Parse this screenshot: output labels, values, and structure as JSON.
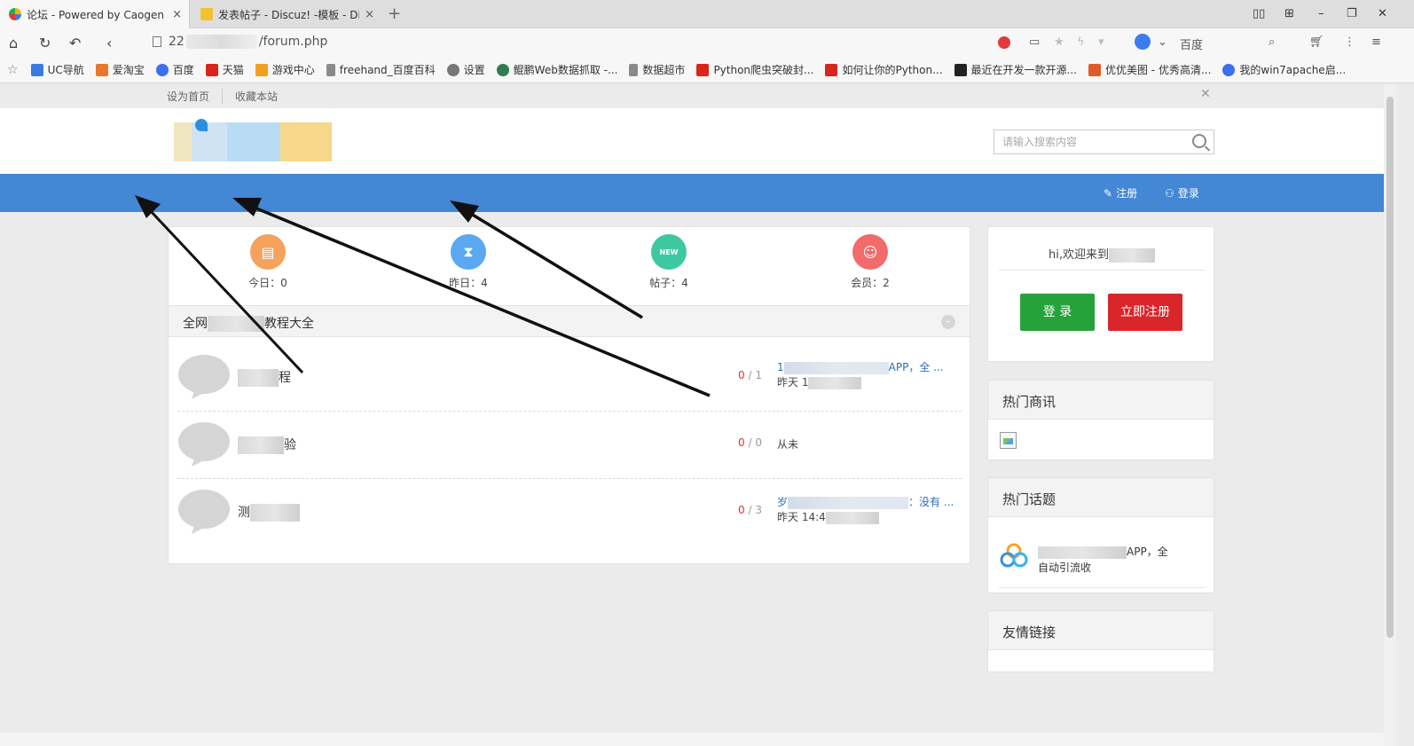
{
  "browser": {
    "tabs": [
      {
        "title": "论坛 - Powered by Caogen",
        "close": "×"
      },
      {
        "title": "发表帖子 - Discuz! -模板 - Di",
        "close": "×"
      }
    ],
    "new_tab": "+",
    "url": {
      "prefix": "22",
      "path": "/forum.php"
    },
    "search_engine": "百度",
    "bookmarks": [
      {
        "label": "UC导航",
        "color": "#3a7be0"
      },
      {
        "label": "爱淘宝",
        "color": "#e8772e"
      },
      {
        "label": "百度",
        "color": "#3b6ef0"
      },
      {
        "label": "天猫",
        "color": "#d8261b"
      },
      {
        "label": "游戏中心",
        "color": "#f0a020"
      },
      {
        "label": "freehand_百度百科",
        "color": "#8a8a8a"
      },
      {
        "label": "设置",
        "color": "#777777"
      },
      {
        "label": "鲲鹏Web数据抓取 -...",
        "color": "#2f7d4f"
      },
      {
        "label": "数据超市",
        "color": "#8a8a8a"
      },
      {
        "label": "Python爬虫突破封...",
        "color": "#d8261b"
      },
      {
        "label": "如何让你的Python...",
        "color": "#d8261b"
      },
      {
        "label": "最近在开发一款开源...",
        "color": "#222222"
      },
      {
        "label": "优优美图 - 优秀高清...",
        "color": "#e05a2a"
      },
      {
        "label": "我的win7apache启...",
        "color": "#3b6ef0"
      }
    ]
  },
  "page": {
    "top_links": [
      "设为首页",
      "收藏本站"
    ],
    "search": {
      "placeholder": "请输入搜索内容"
    },
    "nav": {
      "register": "注册",
      "login": "登录"
    },
    "stats": [
      {
        "label": "今日：0",
        "color": "#f5a25d",
        "icon": "document-icon"
      },
      {
        "label": "昨日：4",
        "color": "#5aa8f0",
        "icon": "hourglass-icon"
      },
      {
        "label": "帖子：4",
        "color": "#3ec8a2",
        "icon": "calendar-new-icon"
      },
      {
        "label": "会员：2",
        "color": "#f26b6b",
        "icon": "user-icon"
      }
    ],
    "section_title": {
      "pre": "全网",
      "post": "教程大全"
    },
    "forums": [
      {
        "name": "程",
        "count_new": "0",
        "count_total": "1",
        "last_post": "APP，全 ...",
        "last_prefix": "1",
        "last_time": "昨天 1"
      },
      {
        "name": "验",
        "count_new": "0",
        "count_total": "0",
        "last_post": "",
        "last_prefix": "",
        "last_time": "从未"
      },
      {
        "name": "测",
        "count_new": "0",
        "count_total": "3",
        "last_post": "：没有 ...",
        "last_prefix": "岁",
        "last_time": "昨天 14:4"
      }
    ],
    "count_separator": "/",
    "sidebar": {
      "welcome": "hi,欢迎来到",
      "login_button": "登 录",
      "register_button": "立即注册",
      "hot_news_title": "热门商讯",
      "hot_topics_title": "热门话题",
      "hot_topic_text_tail": "APP，全",
      "hot_topic_line2": "自动引流收",
      "links_title": "友情链接"
    },
    "colors": {
      "nav": "#4387d5",
      "login_btn": "#25a33a",
      "register_btn": "#d9262a"
    }
  }
}
